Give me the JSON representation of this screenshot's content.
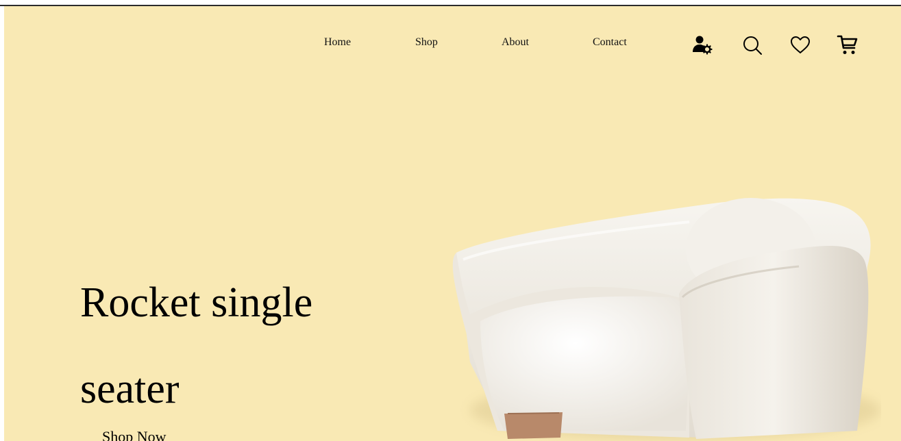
{
  "theme": {
    "background": "#f9e9b4",
    "chair_color": "#f3f0ea",
    "chair_shadow": "#d9d3c7",
    "leg_color": "#b8896a"
  },
  "nav": {
    "links": [
      {
        "label": "Home"
      },
      {
        "label": "Shop"
      },
      {
        "label": "About"
      },
      {
        "label": "Contact"
      }
    ],
    "icons": [
      {
        "name": "user-settings-icon"
      },
      {
        "name": "search-icon"
      },
      {
        "name": "heart-icon"
      },
      {
        "name": "cart-icon"
      }
    ]
  },
  "hero": {
    "title_line1": "Rocket single",
    "title_line2": "seater",
    "cta_label": "Shop Now",
    "image_subject": "white armchair"
  }
}
